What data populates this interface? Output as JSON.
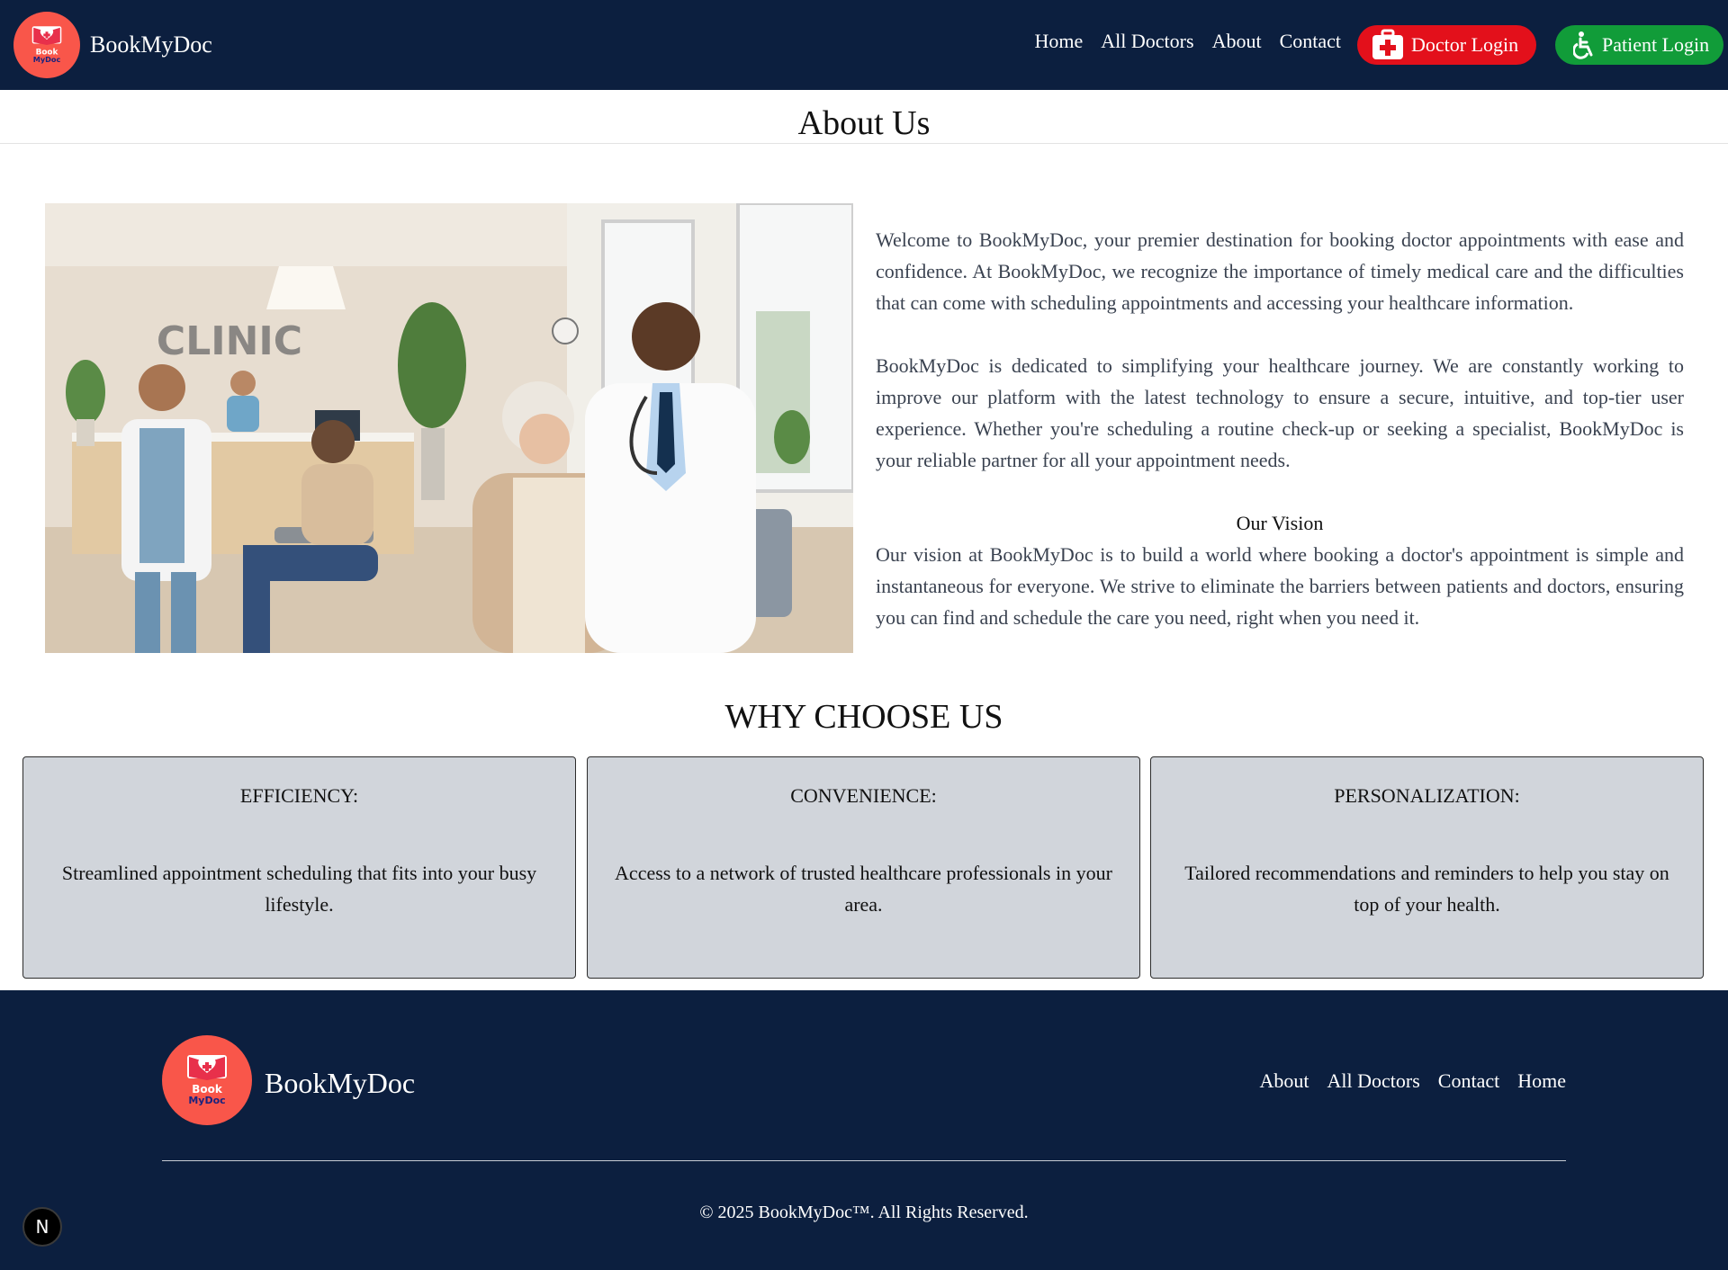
{
  "header": {
    "brand": "BookMyDoc",
    "logo_text_top": "Book",
    "logo_text_bottom": "MyDoc",
    "nav": [
      "Home",
      "All Doctors",
      "About",
      "Contact"
    ],
    "doctor_login": "Doctor Login",
    "patient_login": "Patient Login",
    "doctor_icon": "medical-kit-icon",
    "patient_icon": "wheelchair-icon"
  },
  "about": {
    "title": "About Us",
    "image_sign": "CLINIC",
    "paragraphs": [
      "Welcome to BookMyDoc, your premier destination for booking doctor appointments with ease and confidence. At BookMyDoc, we recognize the importance of timely medical care and the difficulties that can come with scheduling appointments and accessing your healthcare information.",
      "BookMyDoc is dedicated to simplifying your healthcare journey. We are constantly working to improve our platform with the latest technology to ensure a secure, intuitive, and top-tier user experience. Whether you're scheduling a routine check-up or seeking a specialist, BookMyDoc is your reliable partner for all your appointment needs."
    ],
    "vision_title": "Our Vision",
    "vision_text": "Our vision at BookMyDoc is to build a world where booking a doctor's appointment is simple and instantaneous for everyone. We strive to eliminate the barriers between patients and doctors, ensuring you can find and schedule the care you need, right when you need it."
  },
  "why": {
    "title": "WHY CHOOSE US",
    "cards": [
      {
        "title": "EFFICIENCY:",
        "desc": "Streamlined appointment scheduling that fits into your busy lifestyle."
      },
      {
        "title": "CONVENIENCE:",
        "desc": "Access to a network of trusted healthcare professionals in your area."
      },
      {
        "title": "PERSONALIZATION:",
        "desc": "Tailored recommendations and reminders to help you stay on top of your health."
      }
    ]
  },
  "footer": {
    "brand": "BookMyDoc",
    "links": [
      "About",
      "All Doctors",
      "Contact",
      "Home"
    ],
    "copyright": "© 2025 BookMyDoc™. All Rights Reserved."
  },
  "dev_badge": "N",
  "colors": {
    "navy": "#0c1f3f",
    "doctor_red": "#e3101b",
    "patient_green": "#119c39",
    "logo_coral": "#f9564a",
    "card_gray": "#d1d5db"
  }
}
